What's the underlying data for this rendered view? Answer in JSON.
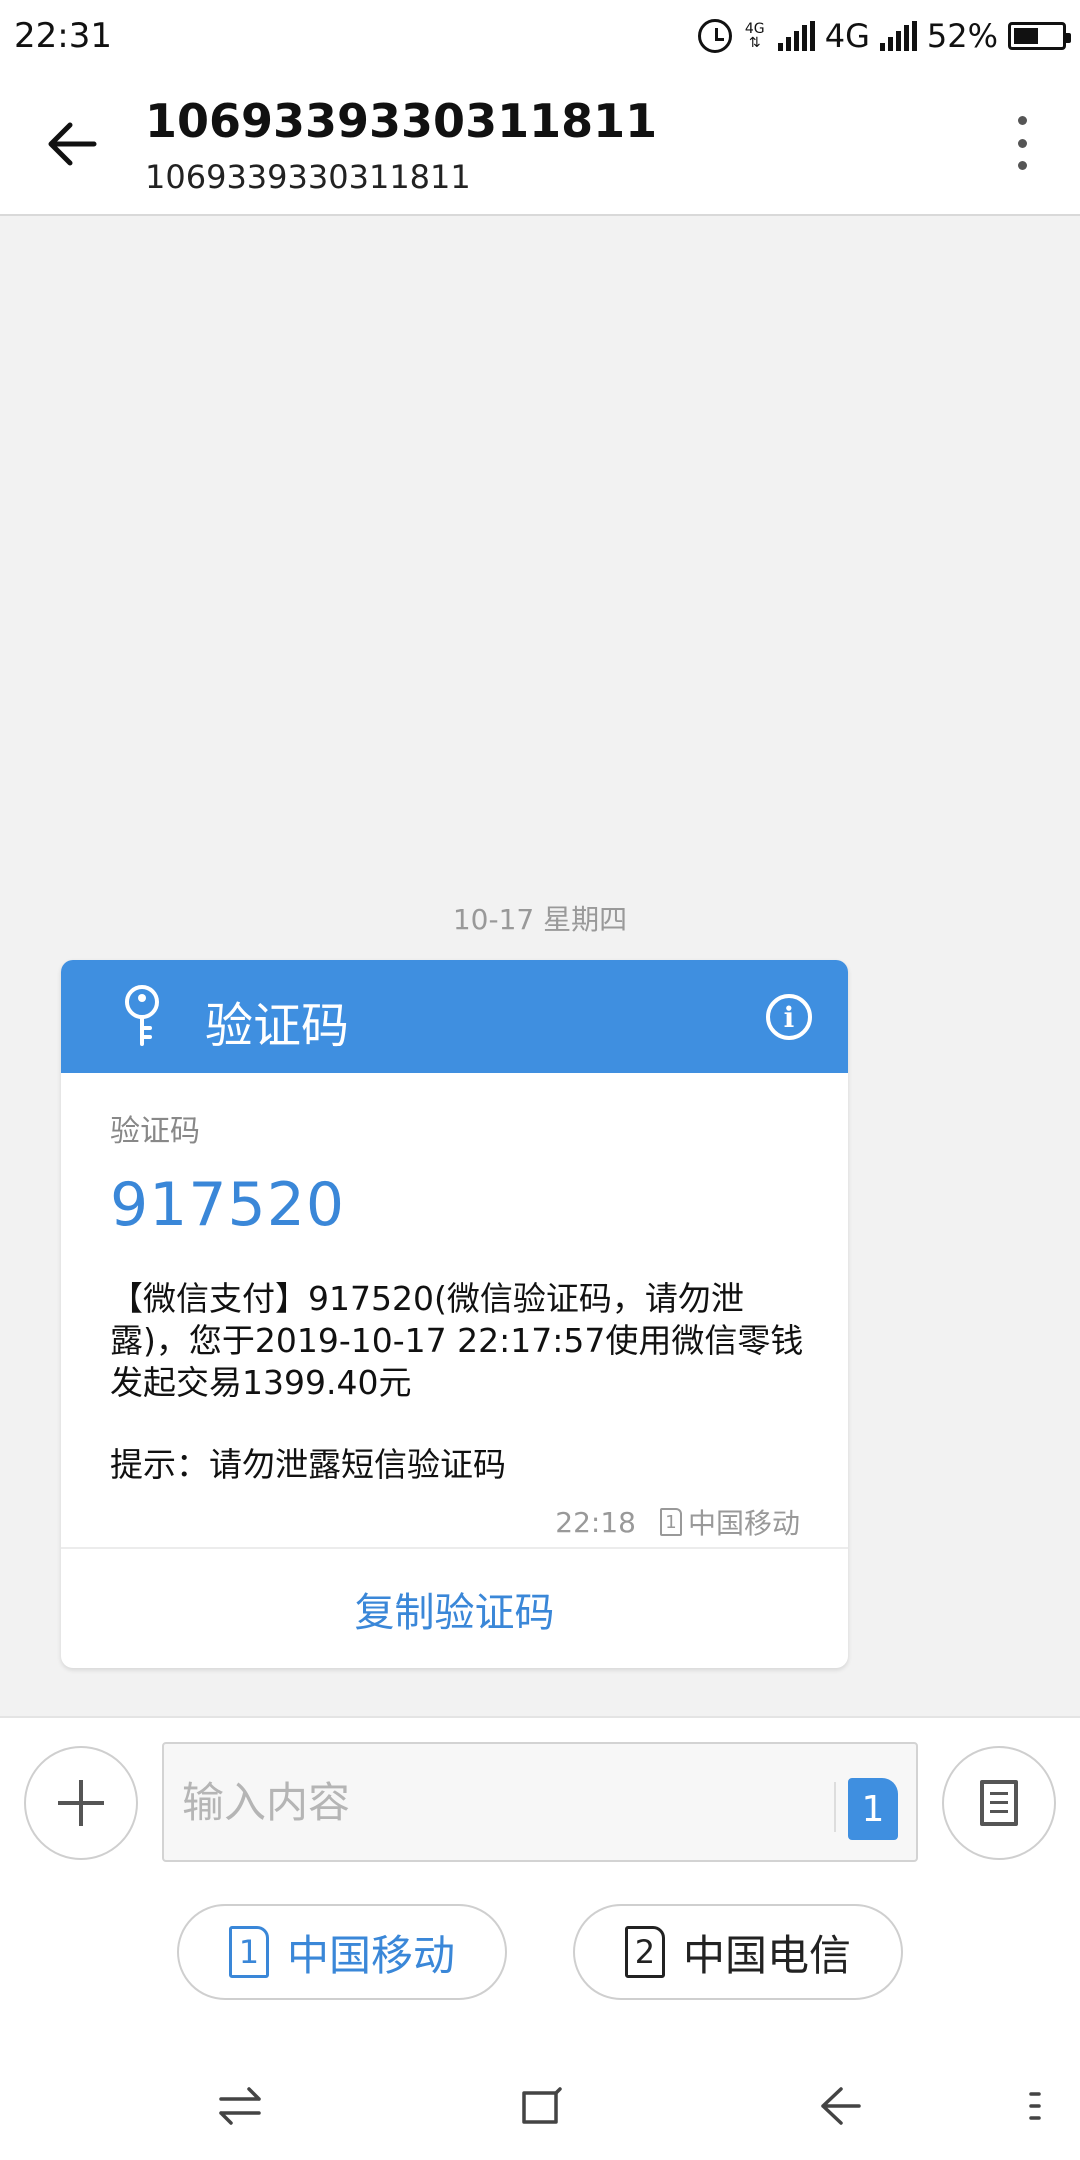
{
  "status_bar": {
    "time": "22:31",
    "network_small": "4G",
    "network": "4G",
    "battery": "52%",
    "battery_level": 0.52
  },
  "header": {
    "title": "1069339330311811",
    "subtitle": "1069339330311811"
  },
  "thread": {
    "date_divider": "10-17  星期四"
  },
  "card": {
    "header_title": "验证码",
    "code_label": "验证码",
    "code": "917520",
    "message": "【微信支付】917520(微信验证码，请勿泄露)，您于2019-10-17 22:17:57使用微信零钱发起交易1399.40元",
    "tip": "提示：请勿泄露短信验证码",
    "time": "22:18",
    "sim_number": "1",
    "carrier": "中国移动",
    "copy_label": "复制验证码"
  },
  "composer": {
    "placeholder": "输入内容",
    "sim_number": "1"
  },
  "carriers": [
    {
      "sim": "1",
      "label": "中国移动",
      "color": "#3a87d8"
    },
    {
      "sim": "2",
      "label": "中国电信",
      "color": "#222222"
    }
  ],
  "colors": {
    "accent": "#3f8fe0",
    "code_text": "#3a87d8"
  },
  "icons": {
    "back": "arrow-left-icon",
    "menu": "more-vertical-icon",
    "key": "key-icon",
    "info": "info-icon",
    "add": "plus-icon",
    "template": "document-icon",
    "nav_switch": "switch-arrows-icon",
    "nav_home": "home-square-icon",
    "nav_back": "back-arrow-icon",
    "nav_more": "more-icon"
  }
}
